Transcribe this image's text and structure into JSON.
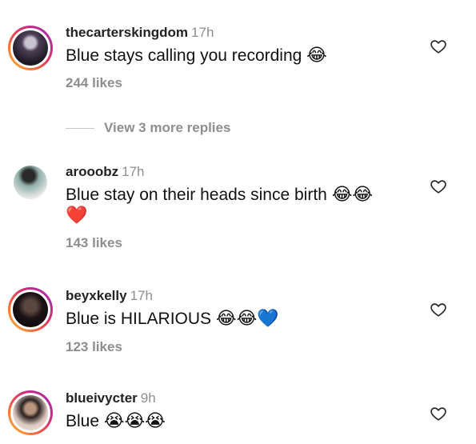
{
  "comments": [
    {
      "username": "thecarterskingdom",
      "time": "17h",
      "text": "Blue stays calling you recording",
      "emoji": "😂",
      "likes": "244 likes",
      "avatar_ring": true
    },
    {
      "username": "arooobz",
      "time": "17h",
      "text": "Blue stay on their heads since birth",
      "emoji": "😂😂",
      "emoji_line2": "❤️",
      "likes": "143 likes",
      "avatar_ring": false
    },
    {
      "username": "beyxkelly",
      "time": "17h",
      "text": "Blue is HILARIOUS",
      "emoji": "😂😂💙",
      "likes": "123 likes",
      "avatar_ring": true
    },
    {
      "username": "blueivycter",
      "time": "9h",
      "text": "Blue",
      "emoji": "😭😭😭",
      "avatar_ring": true
    }
  ],
  "view_more_replies": "View 3 more replies",
  "icons": {
    "like": "heart-outline-icon"
  },
  "colors": {
    "ring_gradient": [
      "#f9c433",
      "#f56040",
      "#d62976",
      "#962fbf"
    ],
    "secondary_text": "#8e8e8e"
  }
}
